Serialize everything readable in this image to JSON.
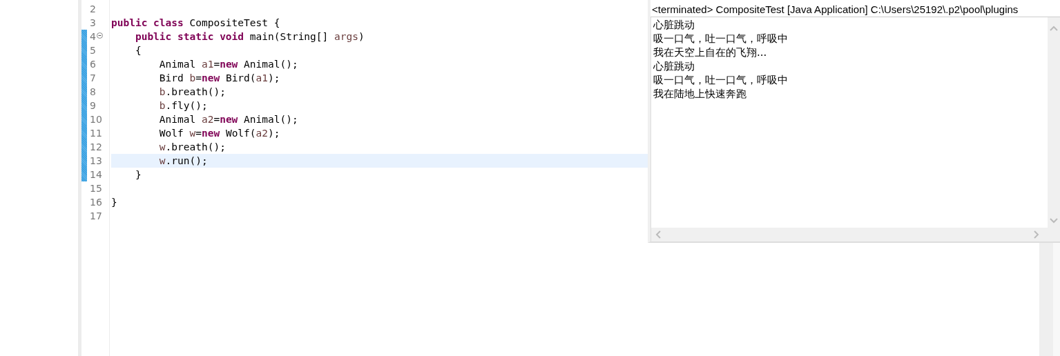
{
  "editor": {
    "lines": [
      {
        "number": "2",
        "changed": false,
        "current": false,
        "collapsible": false
      },
      {
        "number": "3",
        "changed": false,
        "current": false,
        "collapsible": false,
        "tokens": [
          {
            "kind": "keyword",
            "text": "public "
          },
          {
            "kind": "keyword",
            "text": "class"
          },
          {
            "kind": "plain",
            "text": " CompositeTest {"
          }
        ]
      },
      {
        "number": "4",
        "changed": true,
        "current": false,
        "collapsible": true,
        "tokens": [
          {
            "kind": "keyword",
            "text": "    public "
          },
          {
            "kind": "keyword",
            "text": "static "
          },
          {
            "kind": "keyword",
            "text": "void"
          },
          {
            "kind": "plain",
            "text": " main(String[] "
          },
          {
            "kind": "variable",
            "text": "args"
          },
          {
            "kind": "plain",
            "text": ")"
          }
        ]
      },
      {
        "number": "5",
        "changed": true,
        "current": false,
        "collapsible": false,
        "tokens": [
          {
            "kind": "plain",
            "text": "    {"
          }
        ]
      },
      {
        "number": "6",
        "changed": true,
        "current": false,
        "collapsible": false,
        "tokens": [
          {
            "kind": "plain",
            "text": "        Animal "
          },
          {
            "kind": "variable",
            "text": "a1"
          },
          {
            "kind": "plain",
            "text": "="
          },
          {
            "kind": "keyword",
            "text": "new"
          },
          {
            "kind": "plain",
            "text": " Animal();"
          }
        ]
      },
      {
        "number": "7",
        "changed": true,
        "current": false,
        "collapsible": false,
        "tokens": [
          {
            "kind": "plain",
            "text": "        Bird "
          },
          {
            "kind": "variable",
            "text": "b"
          },
          {
            "kind": "plain",
            "text": "="
          },
          {
            "kind": "keyword",
            "text": "new"
          },
          {
            "kind": "plain",
            "text": " Bird("
          },
          {
            "kind": "variable",
            "text": "a1"
          },
          {
            "kind": "plain",
            "text": ");"
          }
        ]
      },
      {
        "number": "8",
        "changed": true,
        "current": false,
        "collapsible": false,
        "tokens": [
          {
            "kind": "variable",
            "text": "        b"
          },
          {
            "kind": "plain",
            "text": ".breath();"
          }
        ]
      },
      {
        "number": "9",
        "changed": true,
        "current": false,
        "collapsible": false,
        "tokens": [
          {
            "kind": "variable",
            "text": "        b"
          },
          {
            "kind": "plain",
            "text": ".fly();"
          }
        ]
      },
      {
        "number": "10",
        "changed": true,
        "current": false,
        "collapsible": false,
        "tokens": [
          {
            "kind": "plain",
            "text": "        Animal "
          },
          {
            "kind": "variable",
            "text": "a2"
          },
          {
            "kind": "plain",
            "text": "="
          },
          {
            "kind": "keyword",
            "text": "new"
          },
          {
            "kind": "plain",
            "text": " Animal();"
          }
        ]
      },
      {
        "number": "11",
        "changed": true,
        "current": false,
        "collapsible": false,
        "tokens": [
          {
            "kind": "plain",
            "text": "        Wolf "
          },
          {
            "kind": "variable",
            "text": "w"
          },
          {
            "kind": "plain",
            "text": "="
          },
          {
            "kind": "keyword",
            "text": "new"
          },
          {
            "kind": "plain",
            "text": " Wolf("
          },
          {
            "kind": "variable",
            "text": "a2"
          },
          {
            "kind": "plain",
            "text": ");"
          }
        ]
      },
      {
        "number": "12",
        "changed": true,
        "current": false,
        "collapsible": false,
        "tokens": [
          {
            "kind": "variable",
            "text": "        w"
          },
          {
            "kind": "plain",
            "text": ".breath();"
          }
        ]
      },
      {
        "number": "13",
        "changed": true,
        "current": true,
        "collapsible": false,
        "tokens": [
          {
            "kind": "variable",
            "text": "        w"
          },
          {
            "kind": "plain",
            "text": ".run();"
          }
        ]
      },
      {
        "number": "14",
        "changed": true,
        "current": false,
        "collapsible": false,
        "tokens": [
          {
            "kind": "plain",
            "text": "    }"
          }
        ]
      },
      {
        "number": "15",
        "changed": false,
        "current": false,
        "collapsible": false
      },
      {
        "number": "16",
        "changed": false,
        "current": false,
        "collapsible": false,
        "tokens": [
          {
            "kind": "plain",
            "text": "}"
          }
        ]
      },
      {
        "number": "17",
        "changed": false,
        "current": false,
        "collapsible": false
      }
    ]
  },
  "console": {
    "header": "<terminated> CompositeTest [Java Application] C:\\Users\\25192\\.p2\\pool\\plugins",
    "output": [
      "心脏跳动",
      "吸一口气，吐一口气，呼吸中",
      "我在天空上自在的飞翔...",
      "心脏跳动",
      "吸一口气，吐一口气，呼吸中",
      "我在陆地上快速奔跑"
    ]
  }
}
